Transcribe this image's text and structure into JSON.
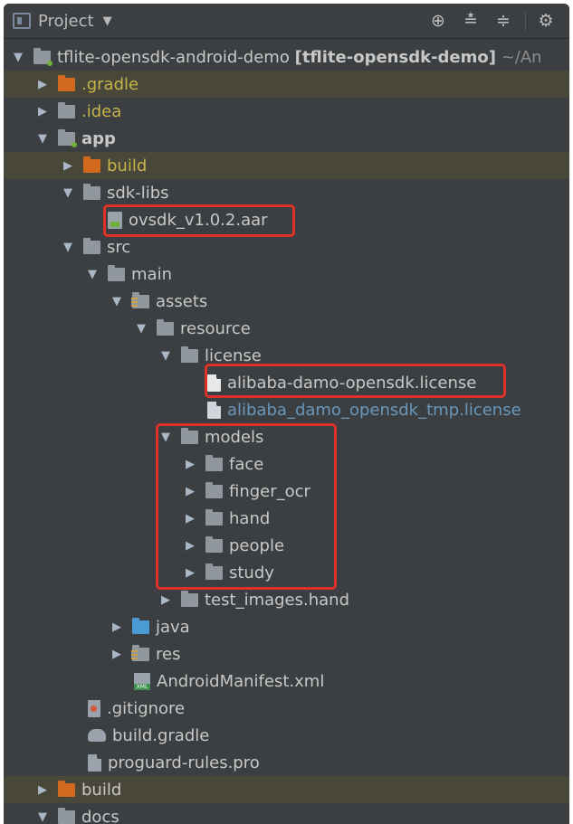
{
  "header": {
    "title": "Project",
    "icons": [
      "locate-icon",
      "expand-all-icon",
      "collapse-all-icon",
      "settings-icon"
    ]
  },
  "tree": {
    "root": {
      "name": "tflite-opensdk-android-demo",
      "module": "[tflite-opensdk-demo]",
      "path": "~/An"
    },
    "gradle": ".gradle",
    "idea": ".idea",
    "app": "app",
    "app_build": "build",
    "sdk_libs": "sdk-libs",
    "aar": "ovsdk_v1.0.2.aar",
    "src": "src",
    "main": "main",
    "assets": "assets",
    "resource": "resource",
    "license": "license",
    "license_file": "alibaba-damo-opensdk.license",
    "license_tmp": "alibaba_damo_opensdk_tmp.license",
    "models": "models",
    "model_face": "face",
    "model_finger_ocr": "finger_ocr",
    "model_hand": "hand",
    "model_people": "people",
    "model_study": "study",
    "test_images": "test_images.hand",
    "java": "java",
    "res": "res",
    "manifest": "AndroidManifest.xml",
    "gitignore": ".gitignore",
    "build_gradle": "build.gradle",
    "proguard": "proguard-rules.pro",
    "build": "build",
    "docs": "docs"
  },
  "colors": {
    "background": "#3c3f41",
    "excluded_row": "#49473a",
    "excluded_text": "#c5b54a",
    "untracked_text": "#6897bb",
    "highlight": "#e0302a"
  }
}
